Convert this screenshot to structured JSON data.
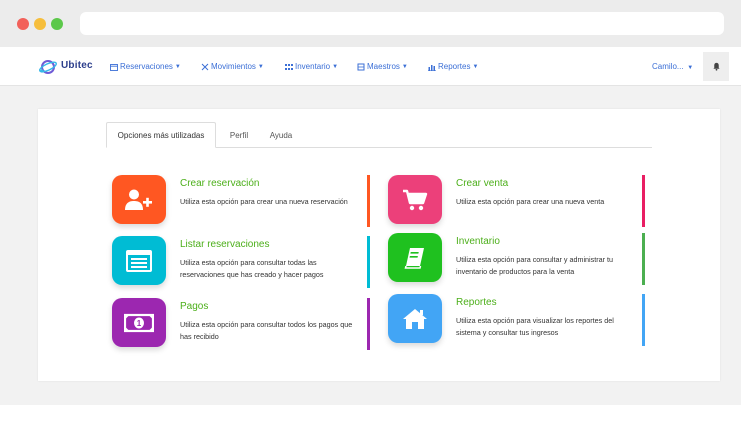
{
  "navbar": {
    "brand": "Ubitec",
    "menu": [
      {
        "label": "Reservaciones"
      },
      {
        "label": "Movimientos"
      },
      {
        "label": "Inventario"
      },
      {
        "label": "Maestros"
      },
      {
        "label": "Reportes"
      }
    ],
    "user": "Camilo..."
  },
  "tabs": [
    {
      "label": "Opciones más utilizadas"
    },
    {
      "label": "Perfil"
    },
    {
      "label": "Ayuda"
    }
  ],
  "items": [
    {
      "title": "Crear reservación",
      "desc": "Utiliza esta opción para crear una nueva reservación",
      "color": "#ff5722",
      "bar_color": "#ff5722",
      "icon": "add-user-icon"
    },
    {
      "title": "Listar reservaciones",
      "desc": "Utiliza esta opción para consultar todas las reservaciones que has creado y hacer pagos",
      "color": "#00bcd4",
      "bar_color": "#00bcd4",
      "icon": "list-window-icon"
    },
    {
      "title": "Pagos",
      "desc": "Utiliza esta opción para consultar todos los pagos que has recibido",
      "color": "#9c27b0",
      "bar_color": "#9c27b0",
      "icon": "money-icon"
    },
    {
      "title": "Crear venta",
      "desc": "Utiliza esta opción para crear una nueva venta",
      "color": "#ec407a",
      "bar_color": "#e91e63",
      "icon": "cart-icon"
    },
    {
      "title": "Inventario",
      "desc": "Utiliza esta opción para consultar y administrar tu inventario de productos para la venta",
      "color": "#1fc11f",
      "bar_color": "#4caf50",
      "icon": "book-icon"
    },
    {
      "title": "Reportes",
      "desc": "Utiliza esta opción para visualizar los reportes del sistema y consultar tus ingresos",
      "color": "#42a5f5",
      "bar_color": "#42a5f5",
      "icon": "home-icon"
    }
  ]
}
